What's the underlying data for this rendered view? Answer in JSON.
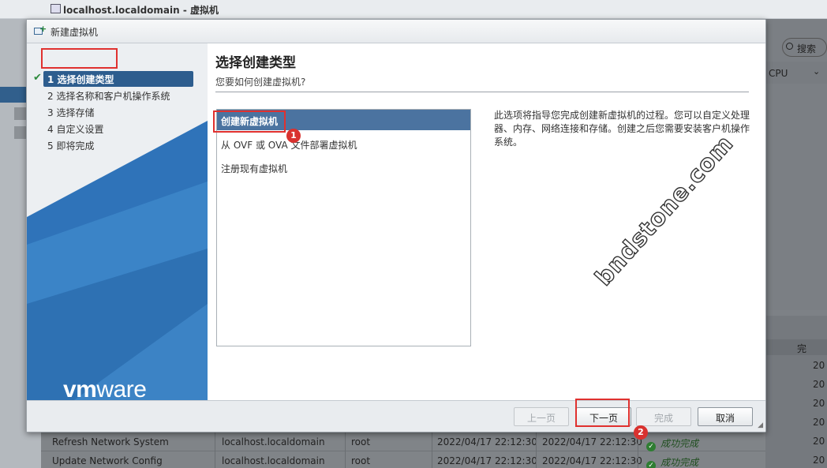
{
  "window": {
    "title": "localhost.localdomain - 虚拟机"
  },
  "search": {
    "label": "搜索"
  },
  "table_partial": {
    "cpu_header": "CPU",
    "right_header": "完",
    "right_cells": [
      "20",
      "20",
      "20",
      "20",
      "20",
      "20"
    ]
  },
  "tasks": [
    {
      "task": "Refresh Network System",
      "target": "localhost.localdomain",
      "initiator": "root",
      "queued": "2022/04/17 22:12:30",
      "started": "2022/04/17 22:12:30",
      "result": "成功完成"
    },
    {
      "task": "Update Network Config",
      "target": "localhost.localdomain",
      "initiator": "root",
      "queued": "2022/04/17 22:12:30",
      "started": "2022/04/17 22:12:30",
      "result": "成功完成"
    }
  ],
  "dialog": {
    "title": "新建虚拟机",
    "steps": [
      {
        "label": "1 选择创建类型",
        "active": true
      },
      {
        "label": "2 选择名称和客户机操作系统",
        "active": false
      },
      {
        "label": "3 选择存储",
        "active": false
      },
      {
        "label": "4 自定义设置",
        "active": false
      },
      {
        "label": "5 即将完成",
        "active": false
      }
    ],
    "brand": {
      "vm": "vm",
      "ware": "ware"
    },
    "heading": "选择创建类型",
    "subheading": "您要如何创建虚拟机?",
    "options": [
      {
        "label": "创建新虚拟机",
        "selected": true
      },
      {
        "label": "从 OVF 或 OVA 文件部署虚拟机",
        "selected": false
      },
      {
        "label": "注册现有虚拟机",
        "selected": false
      }
    ],
    "description": "此选项将指导您完成创建新虚拟机的过程。您可以自定义处理器、内存、网络连接和存储。创建之后您需要安装客户机操作系统。",
    "buttons": {
      "back": "上一页",
      "next": "下一页",
      "finish": "完成",
      "cancel": "取消"
    }
  },
  "annotations": {
    "badge1": "1",
    "badge2": "2"
  },
  "watermark": "bndstone.com",
  "colors": {
    "accent": "#2d5d8e",
    "selected": "#4b73a0",
    "highlight": "#e0312f",
    "success": "#2e7d32"
  }
}
